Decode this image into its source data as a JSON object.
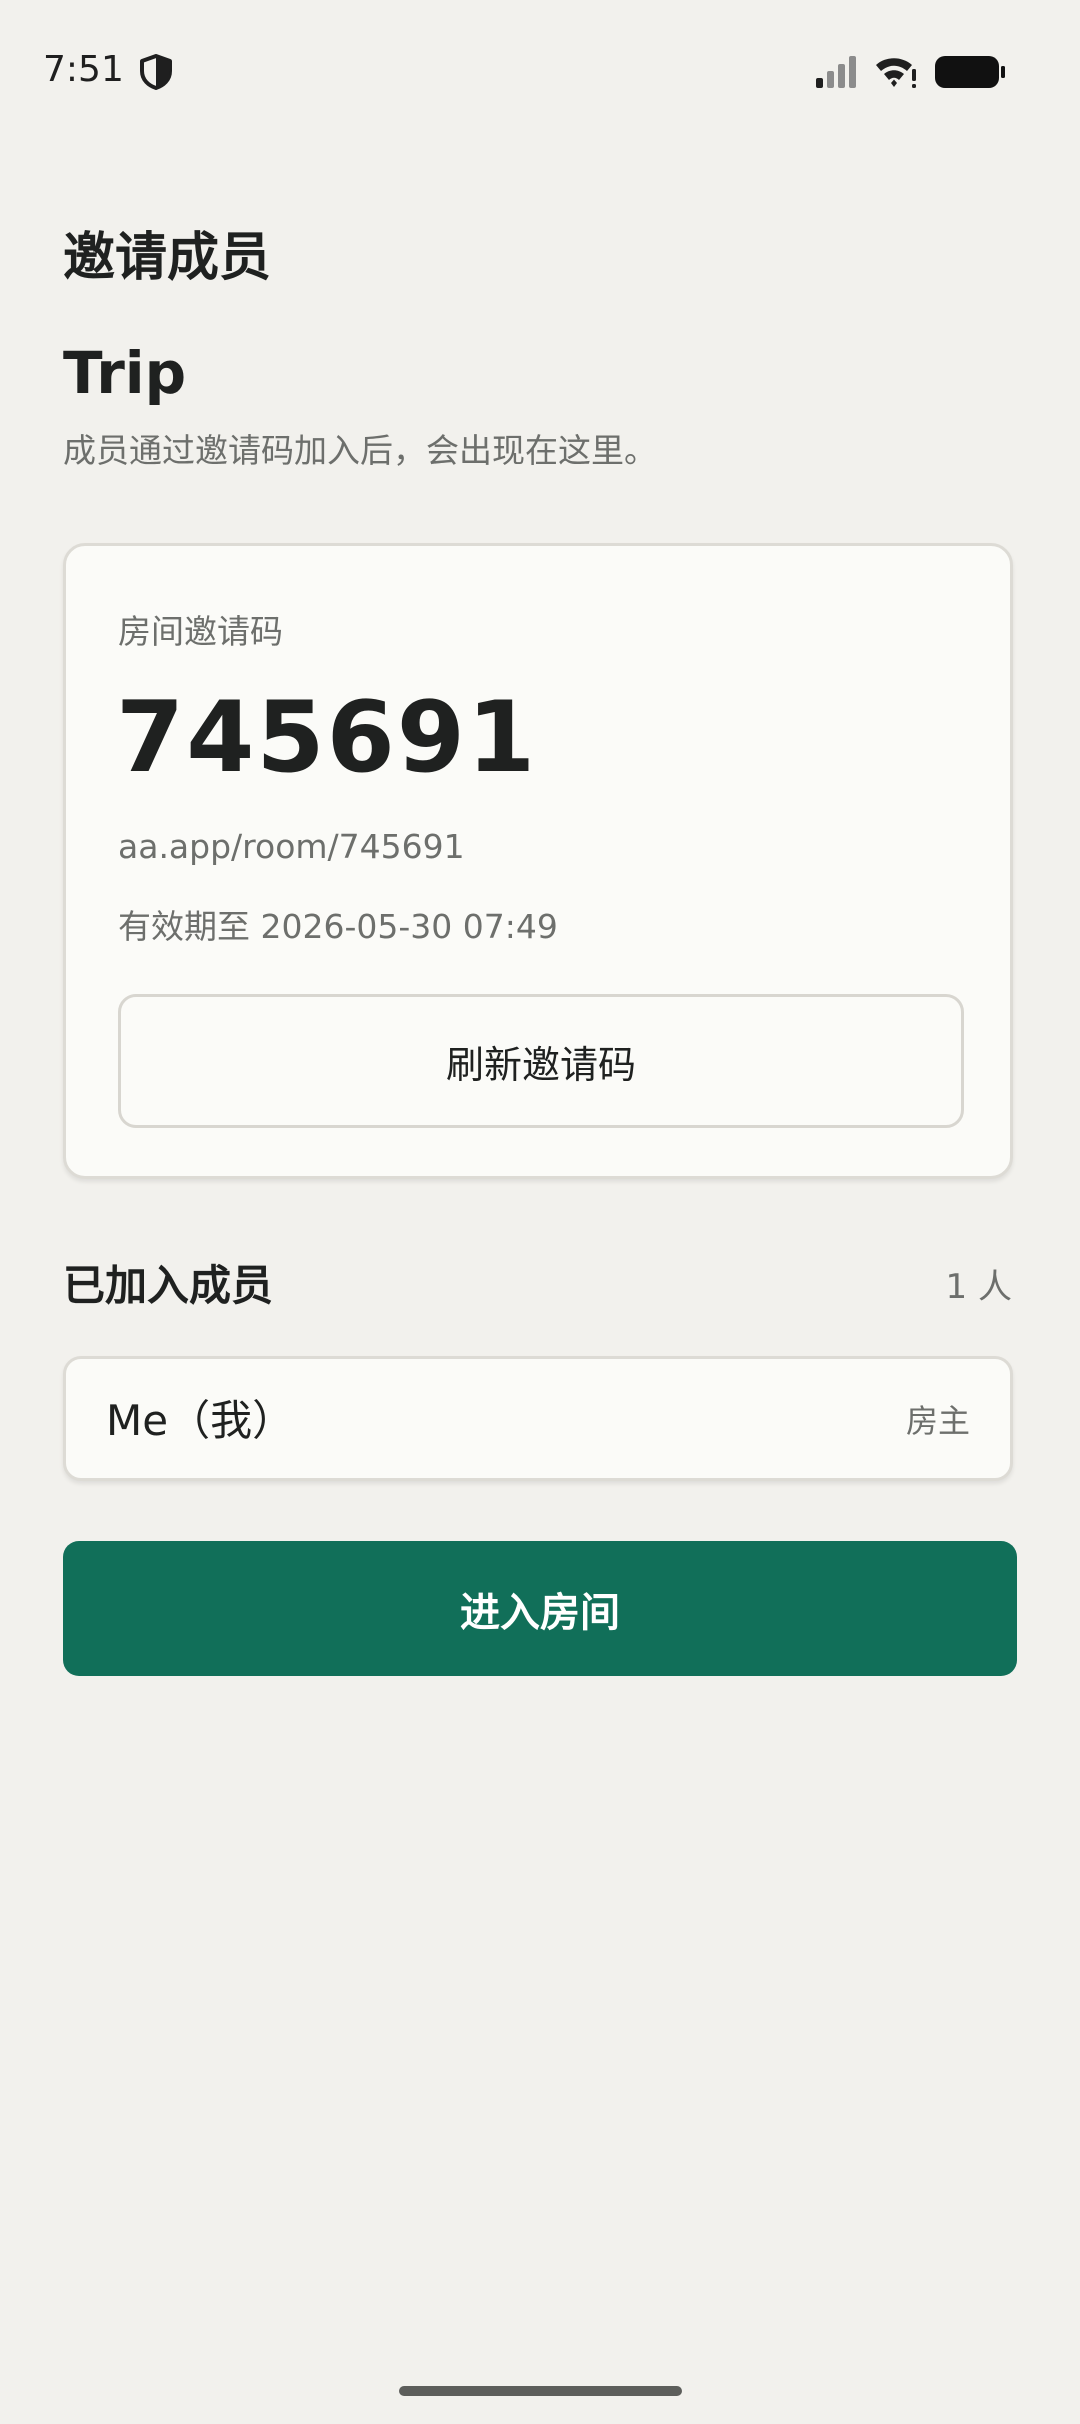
{
  "status_bar": {
    "time": "7:51",
    "icons": [
      "shield-icon",
      "signal-icon",
      "wifi-icon",
      "battery-icon"
    ]
  },
  "header": {
    "title": "邀请成员",
    "room_name": "Trip",
    "hint": "成员通过邀请码加入后，会出现在这里。"
  },
  "invite": {
    "label": "房间邀请码",
    "code": "745691",
    "link": "aa.app/room/745691",
    "expiry": "有效期至 2026-05-30 07:49",
    "refresh_label": "刷新邀请码"
  },
  "members": {
    "title": "已加入成员",
    "count": "1 人",
    "list": [
      {
        "name": "Me（我）",
        "role": "房主"
      }
    ]
  },
  "actions": {
    "enter_label": "进入房间"
  },
  "colors": {
    "background": "#f2f1ed",
    "card": "#fbfbf8",
    "primary": "#116f59",
    "text": "#1f2120",
    "muted": "#6d6f6c"
  }
}
